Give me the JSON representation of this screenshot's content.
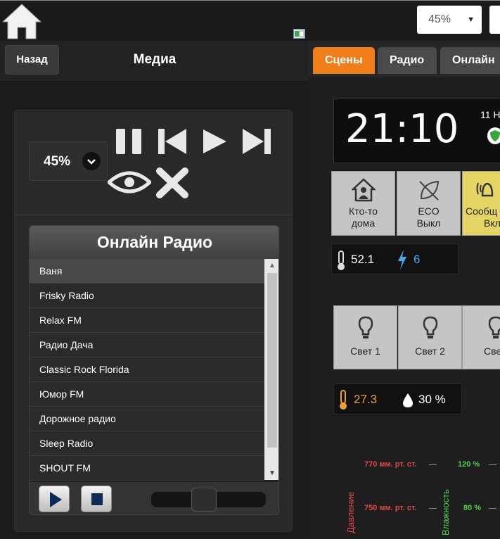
{
  "topbar": {
    "zoom_value": "45%",
    "icons": [
      "home-icon",
      "window-icon"
    ]
  },
  "media": {
    "back_label": "Назад",
    "title": "Медиа",
    "volume_value": "45%",
    "controls": [
      "pause-icon",
      "previous-icon",
      "play-icon",
      "next-icon",
      "eye-icon",
      "close-icon"
    ]
  },
  "radio": {
    "title": "Онлайн Радио",
    "items": [
      "Ваня",
      "Frisky Radio",
      "Relax FM",
      "Радио Дача",
      "Classic Rock Florida",
      "Юмор FM",
      "Дорожное радио",
      "Sleep Radio",
      "SHOUT FM"
    ],
    "selected_index": 0,
    "volume_level": 0.45
  },
  "dashboard": {
    "tabs": [
      "Сцены",
      "Радио",
      "Онлайн"
    ],
    "active_tab": 0,
    "time": "21:10",
    "date": "11 Н",
    "tiles": [
      {
        "line1": "Кто-то",
        "line2": "дома",
        "icon": "house-person-icon"
      },
      {
        "line1": "ECO",
        "line2": "Выкл",
        "icon": "eco-off-icon"
      },
      {
        "line1": "Сообщ",
        "line2": "Вкл",
        "icon": "bell-icon"
      }
    ],
    "sensors1": {
      "temperature": "52.1",
      "power": "6"
    },
    "lights": [
      "Свет 1",
      "Свет 2",
      "Свет"
    ],
    "sensors2": {
      "temperature": "27.3",
      "humidity": "30 %"
    },
    "graph": {
      "pressure_label": "Давление",
      "humidity_label": "Влажность",
      "pressure_ticks": [
        "770 мм. рт. ст.",
        "750 мм. рт. ст."
      ],
      "humidity_ticks": [
        "120 %",
        "80 %"
      ]
    },
    "colors": {
      "accent": "#f07f1a",
      "pressure": "#e04848",
      "humidity": "#4cd44c",
      "power": "#4aa8e8",
      "warm": "#f0a030"
    }
  }
}
